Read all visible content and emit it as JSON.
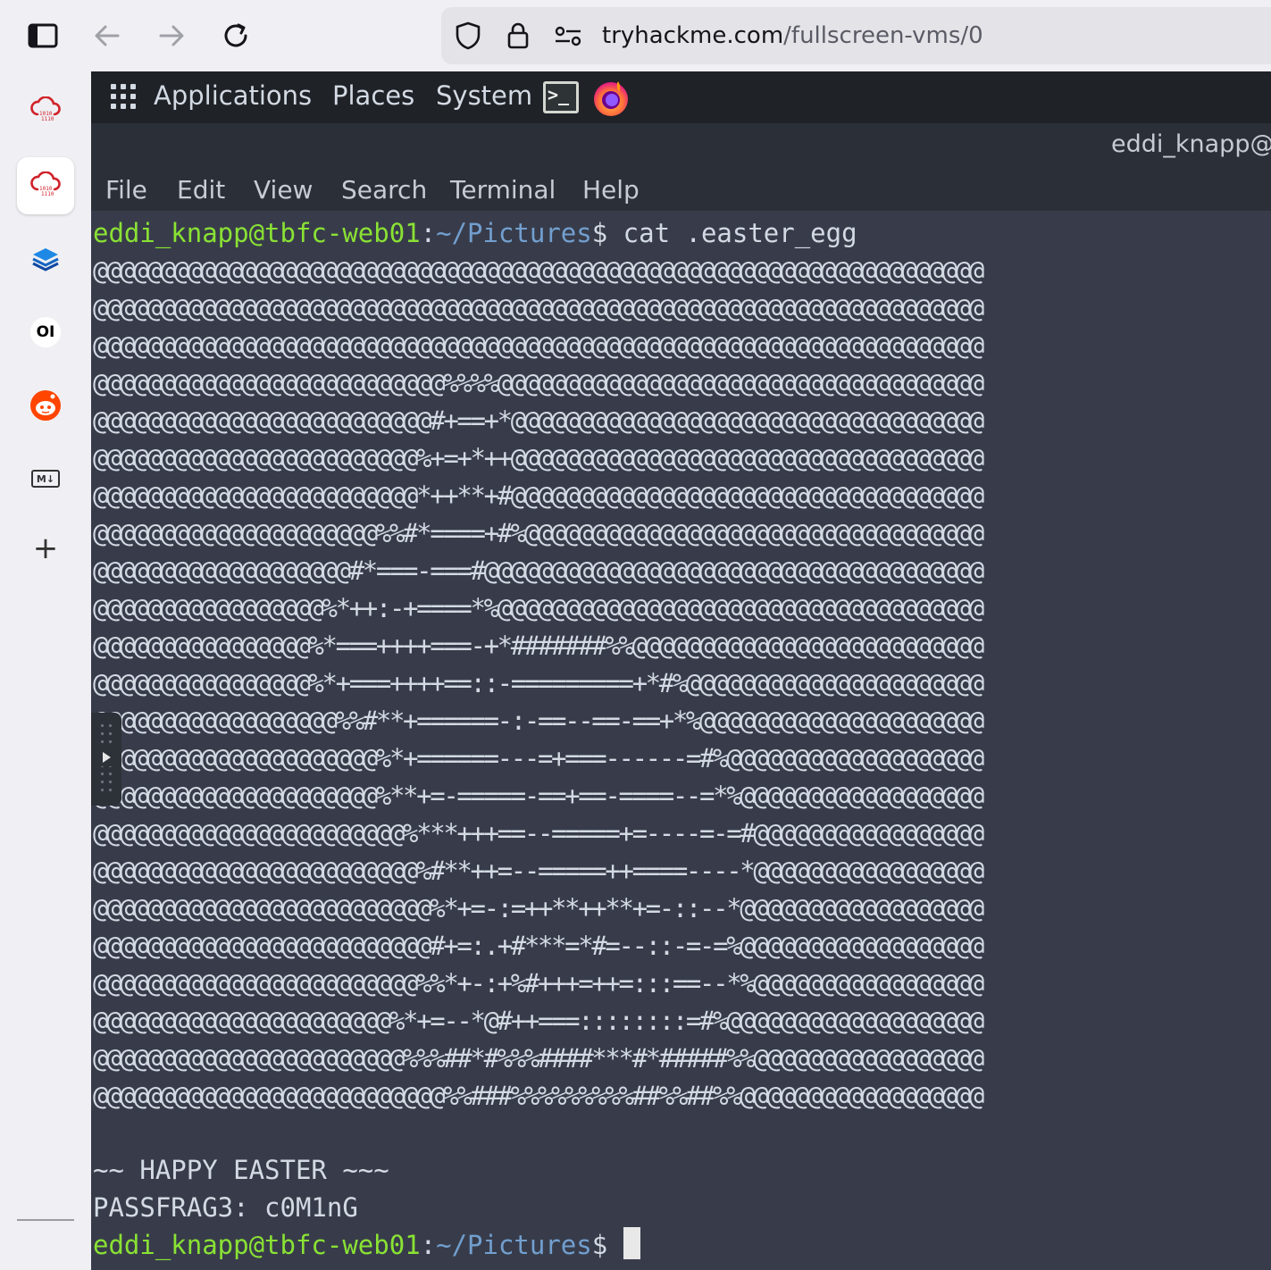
{
  "browser": {
    "url_host": "tryhackme.com",
    "url_path": "/fullscreen-vms/0"
  },
  "sidebar": {
    "items": [
      {
        "name": "sidebar-item-cloud-1"
      },
      {
        "name": "sidebar-item-cloud-2"
      },
      {
        "name": "sidebar-item-layers"
      },
      {
        "name": "sidebar-item-oi",
        "label": "OI"
      },
      {
        "name": "sidebar-item-reddit"
      },
      {
        "name": "sidebar-item-markdown",
        "label": "M↓"
      },
      {
        "name": "sidebar-add",
        "label": "+"
      }
    ]
  },
  "desktop": {
    "panel": {
      "applications": "Applications",
      "places": "Places",
      "system": "System"
    },
    "terminal": {
      "title": "eddi_knapp@",
      "menu": [
        "File",
        "Edit",
        "View",
        "Search",
        "Terminal",
        "Help"
      ],
      "prompt_user": "eddi_knapp@tbfc-web01",
      "prompt_sep": ":",
      "prompt_path": "~/Pictures",
      "prompt_end": "$ ",
      "command": "cat .easter_egg",
      "art": [
        "@@@@@@@@@@@@@@@@@@@@@@@@@@@@@@@@@@@@@@@@@@@@@@@@@@@@@@@@@@@@@@@@@@",
        "@@@@@@@@@@@@@@@@@@@@@@@@@@@@@@@@@@@@@@@@@@@@@@@@@@@@@@@@@@@@@@@@@@",
        "@@@@@@@@@@@@@@@@@@@@@@@@@@@@@@@@@@@@@@@@@@@@@@@@@@@@@@@@@@@@@@@@@@",
        "@@@@@@@@@@@@@@@@@@@@@@@@@@%%%%@@@@@@@@@@@@@@@@@@@@@@@@@@@@@@@@@@@@",
        "@@@@@@@@@@@@@@@@@@@@@@@@@#+==+*@@@@@@@@@@@@@@@@@@@@@@@@@@@@@@@@@@@",
        "@@@@@@@@@@@@@@@@@@@@@@@@%+=+*++@@@@@@@@@@@@@@@@@@@@@@@@@@@@@@@@@@@",
        "@@@@@@@@@@@@@@@@@@@@@@@@*++**+#@@@@@@@@@@@@@@@@@@@@@@@@@@@@@@@@@@@",
        "@@@@@@@@@@@@@@@@@@@@@%%#*====+#%@@@@@@@@@@@@@@@@@@@@@@@@@@@@@@@@@@",
        "@@@@@@@@@@@@@@@@@@@#*===-===#@@@@@@@@@@@@@@@@@@@@@@@@@@@@@@@@@@@@@",
        "@@@@@@@@@@@@@@@@@%*++:-+====*%@@@@@@@@@@@@@@@@@@@@@@@@@@@@@@@@@@@@",
        "@@@@@@@@@@@@@@@@%*===++++===-+*#######%%@@@@@@@@@@@@@@@@@@@@@@@@@@",
        "@@@@@@@@@@@@@@@@%*+===++++==::-=========+*#%@@@@@@@@@@@@@@@@@@@@@@",
        "@@@@@@@@@@@@@@@@@@%%#**+======-:-==--==-==+*%@@@@@@@@@@@@@@@@@@@@@",
        "@@@@@@@@@@@@@@@@@@@@@%*+======---=+===------=#%@@@@@@@@@@@@@@@@@@@",
        "@@@@@@@@@@@@@@@@@@@@@%**+=-=====-==+==-====--=*%@@@@@@@@@@@@@@@@@@",
        "@@@@@@@@@@@@@@@@@@@@@@@%***+++==--=====+=----=-=#@@@@@@@@@@@@@@@@@",
        "@@@@@@@@@@@@@@@@@@@@@@@@%#**++=--=====++====----*@@@@@@@@@@@@@@@@@",
        "@@@@@@@@@@@@@@@@@@@@@@@@@%*+=-:=++**++**+=-::--*@@@@@@@@@@@@@@@@@@",
        "@@@@@@@@@@@@@@@@@@@@@@@@@#+=:.+#***=*#=--::-=-=%@@@@@@@@@@@@@@@@@@",
        "@@@@@@@@@@@@@@@@@@@@@@@@%%*+-:+%#+++=++=:::==--*%@@@@@@@@@@@@@@@@@",
        "@@@@@@@@@@@@@@@@@@@@@@%*+=--*@#++===::::::::=#%@@@@@@@@@@@@@@@@@@@",
        "@@@@@@@@@@@@@@@@@@@@@@@%%%##*#%%%####***#*#####%%@@@@@@@@@@@@@@@@@",
        "@@@@@@@@@@@@@@@@@@@@@@@@@@%%###%%%%%%%%%##%%##%%@@@@@@@@@@@@@@@@@@"
      ],
      "greeting": "~~ HAPPY EASTER ~~~",
      "passfrag": "PASSFRAG3: c0M1nG"
    }
  }
}
